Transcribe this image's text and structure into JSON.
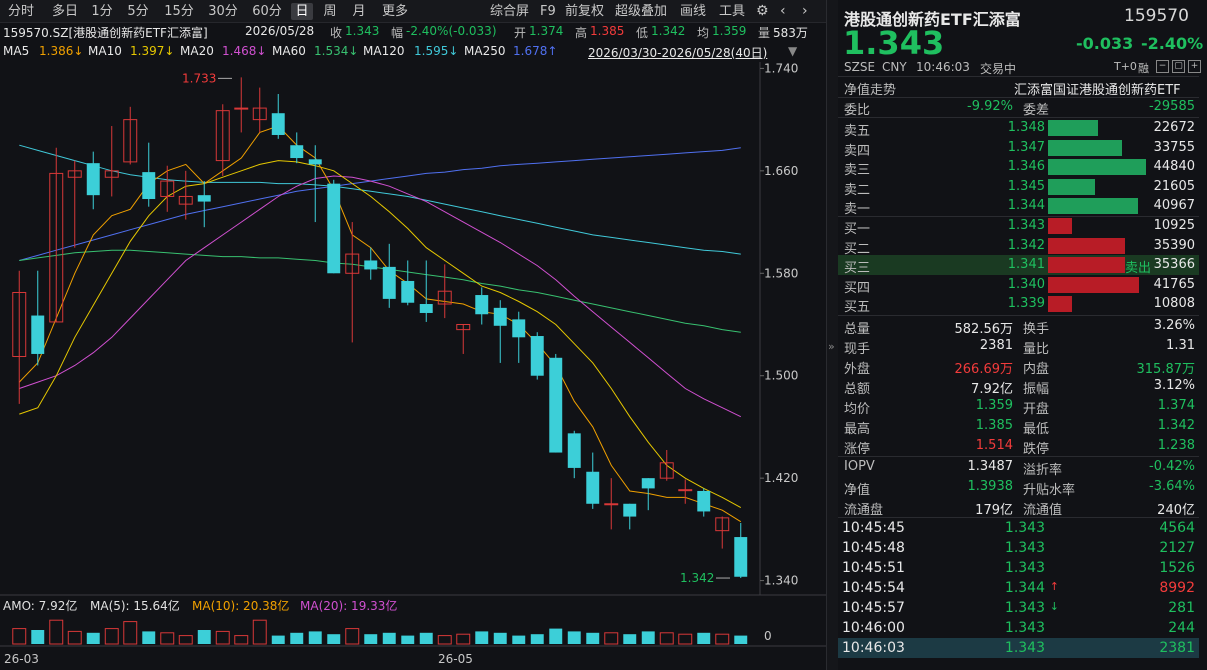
{
  "periods": [
    "分时",
    "多日",
    "1分",
    "5分",
    "15分",
    "30分",
    "60分",
    "日",
    "周",
    "月",
    "更多"
  ],
  "toolbar": [
    "综合屏",
    "F9",
    "前复权",
    "超级叠加",
    "画线",
    "工具"
  ],
  "info": {
    "code": "159570.SZ[港股通创新药ETF汇添富]",
    "date": "2026/05/28",
    "close_label": "收",
    "close": "1.343",
    "chg_label": "幅",
    "chg": "-2.40%(-0.033)",
    "open_label": "开",
    "open": "1.374",
    "high_label": "高",
    "high": "1.385",
    "low_label": "低",
    "low": "1.342",
    "avg_label": "均",
    "avg": "1.359",
    "vol_label": "量",
    "vol": "583万"
  },
  "ma": [
    {
      "name": "MA5",
      "value": "1.386↓",
      "color": "#f0a000"
    },
    {
      "name": "MA10",
      "value": "1.397↓",
      "color": "#e6c800"
    },
    {
      "name": "MA20",
      "value": "1.468↓",
      "color": "#d050d0"
    },
    {
      "name": "MA60",
      "value": "1.534↓",
      "color": "#38c070"
    },
    {
      "name": "MA120",
      "value": "1.595↓",
      "color": "#40c8d8"
    },
    {
      "name": "MA250",
      "value": "1.678↑",
      "color": "#5070f0"
    }
  ],
  "range": "2026/03/30-2026/05/28(40日)",
  "price_axis": [
    "1.740",
    "1.660",
    "1.580",
    "1.500",
    "1.420",
    "1.340"
  ],
  "annot": {
    "hi": "1.733",
    "lo": "1.342"
  },
  "amo": {
    "label": "AMO: 7.92亿",
    "ma5": "MA(5): 15.64亿",
    "ma10": "MA(10): 20.38亿",
    "ma20": "MA(20): 19.33亿",
    "zero": "0"
  },
  "dates": [
    "26-03",
    "26-05"
  ],
  "chart_data": {
    "type": "candlestick",
    "ylim": [
      1.335,
      1.745
    ],
    "candles": [
      [
        1.515,
        1.565,
        1.478,
        1.582
      ],
      [
        1.547,
        1.517,
        1.508,
        1.582
      ],
      [
        1.542,
        1.658,
        1.542,
        1.678
      ],
      [
        1.655,
        1.66,
        1.6,
        1.668
      ],
      [
        1.666,
        1.641,
        1.63,
        1.675
      ],
      [
        1.655,
        1.66,
        1.64,
        1.695
      ],
      [
        1.667,
        1.7,
        1.665,
        1.71
      ],
      [
        1.659,
        1.638,
        1.632,
        1.682
      ],
      [
        1.64,
        1.652,
        1.628,
        1.664
      ],
      [
        1.634,
        1.64,
        1.622,
        1.66
      ],
      [
        1.641,
        1.636,
        1.616,
        1.652
      ],
      [
        1.668,
        1.707,
        1.656,
        1.712
      ],
      [
        1.709,
        1.709,
        1.69,
        1.733
      ],
      [
        1.7,
        1.709,
        1.69,
        1.725
      ],
      [
        1.705,
        1.688,
        1.685,
        1.72
      ],
      [
        1.68,
        1.67,
        1.666,
        1.69
      ],
      [
        1.669,
        1.665,
        1.62,
        1.68
      ],
      [
        1.65,
        1.58,
        1.58,
        1.653
      ],
      [
        1.58,
        1.595,
        1.526,
        1.62
      ],
      [
        1.59,
        1.583,
        1.575,
        1.6
      ],
      [
        1.585,
        1.56,
        1.553,
        1.603
      ],
      [
        1.574,
        1.557,
        1.555,
        1.59
      ],
      [
        1.556,
        1.549,
        1.542,
        1.59
      ],
      [
        1.556,
        1.566,
        1.545,
        1.587
      ],
      [
        1.536,
        1.54,
        1.517,
        1.54
      ],
      [
        1.563,
        1.548,
        1.54,
        1.569
      ],
      [
        1.553,
        1.539,
        1.51,
        1.559
      ],
      [
        1.544,
        1.53,
        1.51,
        1.55
      ],
      [
        1.531,
        1.5,
        1.497,
        1.534
      ],
      [
        1.514,
        1.44,
        1.44,
        1.517
      ],
      [
        1.455,
        1.428,
        1.42,
        1.457
      ],
      [
        1.425,
        1.4,
        1.396,
        1.44
      ],
      [
        1.4,
        1.4,
        1.38,
        1.42
      ],
      [
        1.4,
        1.39,
        1.38,
        1.4
      ],
      [
        1.42,
        1.412,
        1.395,
        1.42
      ],
      [
        1.42,
        1.432,
        1.418,
        1.442
      ],
      [
        1.411,
        1.411,
        1.4,
        1.419
      ],
      [
        1.41,
        1.394,
        1.39,
        1.412
      ],
      [
        1.379,
        1.389,
        1.365,
        1.39
      ],
      [
        1.374,
        1.343,
        1.342,
        1.385
      ]
    ],
    "ma5": [
      1.495,
      1.51,
      1.545,
      1.58,
      1.61,
      1.625,
      1.63,
      1.65,
      1.66,
      1.665,
      1.65,
      1.66,
      1.67,
      1.69,
      1.695,
      1.68,
      1.67,
      1.645,
      1.61,
      1.6,
      1.582,
      1.572,
      1.56,
      1.558,
      1.556,
      1.55,
      1.548,
      1.54,
      1.525,
      1.508,
      1.48,
      1.46,
      1.43,
      1.41,
      1.408,
      1.405,
      1.405,
      1.4,
      1.395,
      1.386
    ],
    "ma10": [
      1.47,
      1.475,
      1.5,
      1.53,
      1.555,
      1.58,
      1.605,
      1.625,
      1.64,
      1.648,
      1.65,
      1.655,
      1.66,
      1.665,
      1.668,
      1.667,
      1.664,
      1.66,
      1.65,
      1.64,
      1.628,
      1.615,
      1.6,
      1.59,
      1.58,
      1.57,
      1.565,
      1.558,
      1.55,
      1.54,
      1.525,
      1.51,
      1.49,
      1.468,
      1.448,
      1.43,
      1.42,
      1.412,
      1.405,
      1.397
    ],
    "ma20": [
      1.49,
      1.495,
      1.5,
      1.508,
      1.518,
      1.53,
      1.545,
      1.56,
      1.575,
      1.59,
      1.6,
      1.61,
      1.62,
      1.63,
      1.64,
      1.648,
      1.654,
      1.656,
      1.655,
      1.652,
      1.648,
      1.642,
      1.636,
      1.628,
      1.62,
      1.612,
      1.604,
      1.595,
      1.586,
      1.575,
      1.562,
      1.55,
      1.538,
      1.526,
      1.514,
      1.502,
      1.49,
      1.482,
      1.475,
      1.468
    ],
    "ma60": [
      1.59,
      1.592,
      1.594,
      1.596,
      1.597,
      1.598,
      1.598,
      1.597,
      1.596,
      1.595,
      1.594,
      1.593,
      1.593,
      1.592,
      1.592,
      1.591,
      1.59,
      1.588,
      1.587,
      1.585,
      1.583,
      1.581,
      1.579,
      1.577,
      1.575,
      1.572,
      1.57,
      1.567,
      1.565,
      1.562,
      1.559,
      1.556,
      1.553,
      1.55,
      1.547,
      1.544,
      1.541,
      1.539,
      1.536,
      1.534
    ],
    "ma120": [
      1.68,
      1.676,
      1.672,
      1.668,
      1.664,
      1.66,
      1.657,
      1.655,
      1.653,
      1.652,
      1.651,
      1.651,
      1.651,
      1.651,
      1.65,
      1.65,
      1.649,
      1.648,
      1.646,
      1.644,
      1.642,
      1.64,
      1.637,
      1.634,
      1.631,
      1.628,
      1.625,
      1.622,
      1.619,
      1.616,
      1.613,
      1.61,
      1.608,
      1.606,
      1.604,
      1.602,
      1.6,
      1.598,
      1.597,
      1.595
    ],
    "ma250": [
      1.59,
      1.594,
      1.598,
      1.602,
      1.606,
      1.61,
      1.614,
      1.618,
      1.622,
      1.626,
      1.629,
      1.632,
      1.635,
      1.638,
      1.641,
      1.644,
      1.646,
      1.648,
      1.65,
      1.652,
      1.654,
      1.656,
      1.658,
      1.659,
      1.661,
      1.662,
      1.664,
      1.665,
      1.666,
      1.667,
      1.668,
      1.669,
      1.67,
      1.671,
      1.672,
      1.673,
      1.674,
      1.675,
      1.676,
      1.678
    ],
    "volume": [
      0.55,
      0.5,
      0.85,
      0.45,
      0.4,
      0.55,
      0.8,
      0.45,
      0.4,
      0.3,
      0.5,
      0.45,
      0.3,
      0.85,
      0.3,
      0.4,
      0.45,
      0.35,
      0.55,
      0.35,
      0.4,
      0.3,
      0.4,
      0.3,
      0.35,
      0.45,
      0.4,
      0.3,
      0.35,
      0.55,
      0.45,
      0.4,
      0.4,
      0.35,
      0.45,
      0.4,
      0.35,
      0.4,
      0.35,
      0.3
    ]
  },
  "right": {
    "name": "港股通创新药ETF汇添富",
    "code": "159570",
    "price": "1.343",
    "change": "-0.033",
    "pct": "-2.40%",
    "exch": "SZSE",
    "cur": "CNY",
    "time": "10:46:03",
    "status": "交易中",
    "t0": "T+0",
    "rong": "融",
    "nav_trend": "净值走势",
    "index_name": "汇添富国证港股通创新药ETF",
    "weibi_label": "委比",
    "weibi": "-9.92%",
    "weicha_label": "委差",
    "weicha": "-29585",
    "asks": [
      {
        "label": "卖五",
        "price": "1.348",
        "vol": "22672",
        "ratio": 0.506
      },
      {
        "label": "卖四",
        "price": "1.347",
        "vol": "33755",
        "ratio": 0.753
      },
      {
        "label": "卖三",
        "price": "1.346",
        "vol": "44840",
        "ratio": 1.0
      },
      {
        "label": "卖二",
        "price": "1.345",
        "vol": "21605",
        "ratio": 0.482
      },
      {
        "label": "卖一",
        "price": "1.344",
        "vol": "40967",
        "ratio": 0.914
      }
    ],
    "bids": [
      {
        "label": "买一",
        "price": "1.343",
        "vol": "10925",
        "ratio": 0.244
      },
      {
        "label": "买二",
        "price": "1.342",
        "vol": "35390",
        "ratio": 0.789
      },
      {
        "label": "买三",
        "price": "1.341",
        "vol": "35366",
        "ratio": 0.789,
        "tag": "卖出"
      },
      {
        "label": "买四",
        "price": "1.340",
        "vol": "41765",
        "ratio": 0.931
      },
      {
        "label": "买五",
        "price": "1.339",
        "vol": "10808",
        "ratio": 0.241
      }
    ],
    "stats": [
      {
        "l1": "总量",
        "v1": "582.56万",
        "c1": "white",
        "l2": "换手",
        "v2": "3.26%",
        "c2": "white"
      },
      {
        "l1": "现手",
        "v1": "2381",
        "c1": "white",
        "l2": "量比",
        "v2": "1.31",
        "c2": "white"
      },
      {
        "l1": "外盘",
        "v1": "266.69万",
        "c1": "red",
        "l2": "内盘",
        "v2": "315.87万",
        "c2": "green"
      },
      {
        "l1": "总额",
        "v1": "7.92亿",
        "c1": "white",
        "l2": "振幅",
        "v2": "3.12%",
        "c2": "white"
      },
      {
        "l1": "均价",
        "v1": "1.359",
        "c1": "green",
        "l2": "开盘",
        "v2": "1.374",
        "c2": "green"
      },
      {
        "l1": "最高",
        "v1": "1.385",
        "c1": "green",
        "l2": "最低",
        "v2": "1.342",
        "c2": "green"
      },
      {
        "l1": "涨停",
        "v1": "1.514",
        "c1": "red",
        "l2": "跌停",
        "v2": "1.238",
        "c2": "green"
      }
    ],
    "stats2": [
      {
        "l1": "IOPV",
        "v1": "1.3487",
        "c1": "white",
        "l2": "溢折率",
        "v2": "-0.42%",
        "c2": "green"
      },
      {
        "l1": "净值",
        "v1": "1.3938",
        "c1": "green",
        "l2": "升贴水率",
        "v2": "-3.64%",
        "c2": "green"
      },
      {
        "l1": "流通盘",
        "v1": "179亿",
        "c1": "white",
        "l2": "流通值",
        "v2": "240亿",
        "c2": "white"
      }
    ],
    "ticks": [
      {
        "time": "10:45:45",
        "price": "1.343",
        "vol": "4564",
        "c": "green",
        "arrow": ""
      },
      {
        "time": "10:45:48",
        "price": "1.343",
        "vol": "2127",
        "c": "green",
        "arrow": ""
      },
      {
        "time": "10:45:51",
        "price": "1.343",
        "vol": "1526",
        "c": "green",
        "arrow": ""
      },
      {
        "time": "10:45:54",
        "price": "1.344",
        "vol": "8992",
        "c": "red",
        "arrow": "up"
      },
      {
        "time": "10:45:57",
        "price": "1.343",
        "vol": "281",
        "c": "green",
        "arrow": "down"
      },
      {
        "time": "10:46:00",
        "price": "1.343",
        "vol": "244",
        "c": "green",
        "arrow": ""
      },
      {
        "time": "10:46:03",
        "price": "1.343",
        "vol": "2381",
        "c": "green",
        "arrow": ""
      }
    ]
  }
}
